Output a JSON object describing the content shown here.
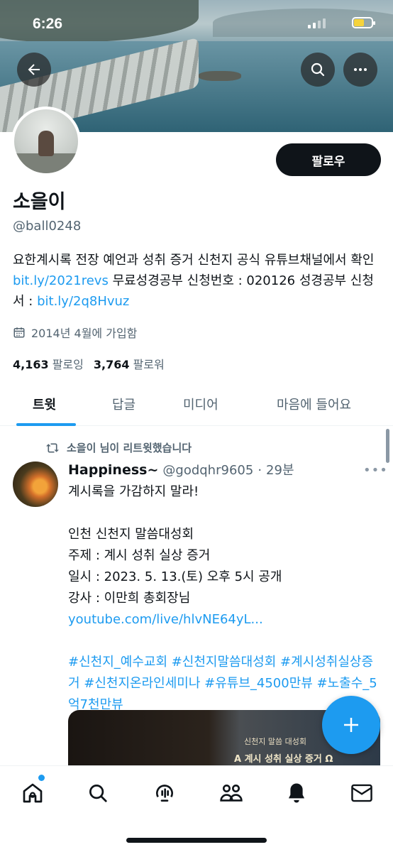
{
  "status_bar": {
    "time": "6:26"
  },
  "profile": {
    "display_name": "소을이",
    "handle": "@ball0248",
    "follow_label": "팔로우",
    "bio_text_1": "요한계시록 전장 예언과 성취 증거 신천지 공식 유튜브채널에서 확인 ",
    "bio_link_1": "bit.ly/2021revs",
    "bio_text_2": " 무료성경공부 신청번호 : 020126 성경공부 신청서 : ",
    "bio_link_2": "bit.ly/2q8Hvuz",
    "joined": "2014년 4월에 가입함",
    "following_count": "4,163",
    "following_label": "팔로잉",
    "followers_count": "3,764",
    "followers_label": "팔로워"
  },
  "tabs": [
    {
      "label": "트윗",
      "active": true
    },
    {
      "label": "답글",
      "active": false
    },
    {
      "label": "미디어",
      "active": false
    },
    {
      "label": "마음에 들어요",
      "active": false
    }
  ],
  "tweet": {
    "retweet_note": "소을이 님이 리트윗했습니다",
    "author_name": "Happiness~",
    "author_handle": "@godqhr9605",
    "separator": "·",
    "time": "29분",
    "lines": [
      "계시록을 가감하지 말라!",
      "",
      "인천 신천지 말씀대성회",
      "주제 : 계시 성취 실상 증거",
      "일시 : 2023. 5. 13.(토) 오후 5시 공개",
      "강사 : 이만희 총회장님"
    ],
    "link": "youtube.com/live/hlvNE64yL...",
    "hashtags": "#신천지_예수교회 #신천지말씀대성회 #계시성취실상증거 #신천지온라인세미나 #유튜브_4500만뷰 #노출수_5억7천만뷰",
    "media_caption_small": "신천지 말씀 대성회",
    "media_caption_title": "A 계시 성취 실상 증거 Ω"
  },
  "icons": {
    "back": "arrow-left-icon",
    "search": "search-icon",
    "more": "more-icon",
    "calendar": "calendar-icon",
    "retweet": "retweet-icon",
    "compose": "plus-icon",
    "nav": [
      "home-icon",
      "search-icon",
      "spaces-icon",
      "communities-icon",
      "bell-icon",
      "mail-icon"
    ]
  },
  "colors": {
    "accent": "#1d9bf0",
    "text": "#0f1419",
    "secondary": "#536471"
  }
}
